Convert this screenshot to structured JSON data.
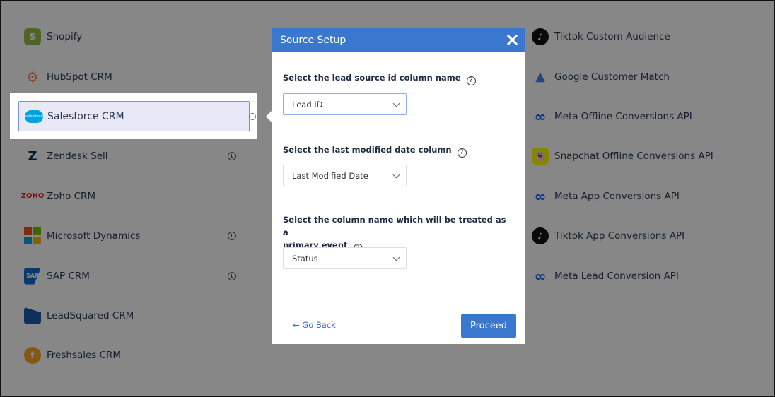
{
  "left_integrations": [
    {
      "label": "Shopify",
      "icon": "shopify-icon",
      "glyph": "S",
      "cls": "shopify",
      "clock": false
    },
    {
      "label": "HubSpot CRM",
      "icon": "hubspot-icon",
      "glyph": "⚙",
      "cls": "hubspot",
      "clock": false
    },
    {
      "label": "Salesforce CRM",
      "icon": "salesforce-icon",
      "glyph": "",
      "cls": "",
      "clock": false
    },
    {
      "label": "Zendesk Sell",
      "icon": "zendesk-icon",
      "glyph": "Z",
      "cls": "zendesk",
      "clock": true
    },
    {
      "label": "Zoho CRM",
      "icon": "zoho-icon",
      "glyph": "ZOHO",
      "cls": "zoho",
      "clock": false
    },
    {
      "label": "Microsoft Dynamics",
      "icon": "microsoft-icon",
      "glyph": "",
      "cls": "ms",
      "clock": true
    },
    {
      "label": "SAP CRM",
      "icon": "sap-icon",
      "glyph": "SAP",
      "cls": "sap",
      "clock": true
    },
    {
      "label": "LeadSquared CRM",
      "icon": "leadsquared-icon",
      "glyph": "",
      "cls": "lsq",
      "clock": false
    },
    {
      "label": "Freshsales CRM",
      "icon": "freshsales-icon",
      "glyph": "f",
      "cls": "fresh",
      "clock": false
    }
  ],
  "right_integrations": [
    {
      "label": "Tiktok Custom Audience",
      "icon": "tiktok-icon",
      "glyph": "♪",
      "cls": "tiktok"
    },
    {
      "label": "Google Customer Match",
      "icon": "google-ads-icon",
      "glyph": "▲",
      "cls": "google"
    },
    {
      "label": "Meta Offline Conversions API",
      "icon": "meta-icon",
      "glyph": "∞",
      "cls": "meta"
    },
    {
      "label": "Snapchat Offline Conversions API",
      "icon": "snapchat-icon",
      "glyph": "👻",
      "cls": "snap"
    },
    {
      "label": "Meta App Conversions API",
      "icon": "meta-icon",
      "glyph": "∞",
      "cls": "meta"
    },
    {
      "label": "Tiktok App Conversions API",
      "icon": "tiktok-icon",
      "glyph": "♪",
      "cls": "tiktok"
    },
    {
      "label": "Meta Lead Conversion API",
      "icon": "meta-icon",
      "glyph": "∞",
      "cls": "meta"
    }
  ],
  "selected_source": {
    "label": "Salesforce CRM",
    "logo_text": "salesforce"
  },
  "modal": {
    "title": "Source Setup",
    "q1_label": "Select the lead source id column name",
    "q1_value": "Lead ID",
    "q2_label": "Select the last modified date column",
    "q2_value": "Last Modified Date",
    "q3_label_line1": "Select the column name which will be treated as a",
    "q3_label_line2": "primary event",
    "q3_value": "Status",
    "help_glyph": "?",
    "back_label": "Go Back",
    "back_arrow": "←",
    "proceed_label": "Proceed"
  },
  "colors": {
    "accent": "#3a78d0",
    "link": "#2e6fc4",
    "overlay": "rgba(0,0,0,0.47)"
  }
}
